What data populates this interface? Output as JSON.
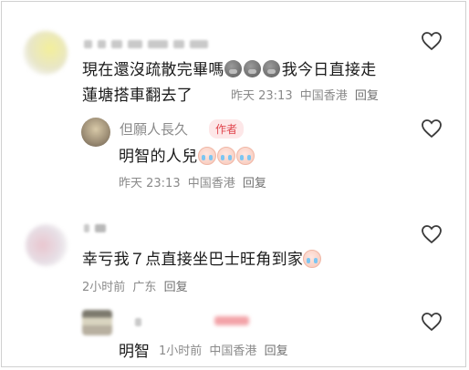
{
  "comments": [
    {
      "text_line1": "現在還沒疏散完畢嗎",
      "emoji_count": 3,
      "text_line1b": "我今日直接走",
      "text_line2": "蓮塘搭車翻去了",
      "time": "昨天 23:13",
      "location": "中国香港",
      "reply_label": "回复",
      "reply": {
        "username": "但願人長久",
        "badge": "作者",
        "text": "明智的人兒",
        "emoji_count": 3,
        "time": "昨天 23:13",
        "location": "中国香港",
        "reply_label": "回复"
      }
    },
    {
      "text": "幸亏我７点直接坐巴士旺角到家",
      "time": "2小时前",
      "location": "广东",
      "reply_label": "回复",
      "reply": {
        "text": "明智",
        "time": "1小时前",
        "location": "中国香港",
        "reply_label": "回复"
      }
    }
  ],
  "icons": {
    "like": "heart-outline-icon",
    "emoji_gray": "gray-face-emoji-icon",
    "emoji_cry": "crying-face-emoji-icon"
  }
}
